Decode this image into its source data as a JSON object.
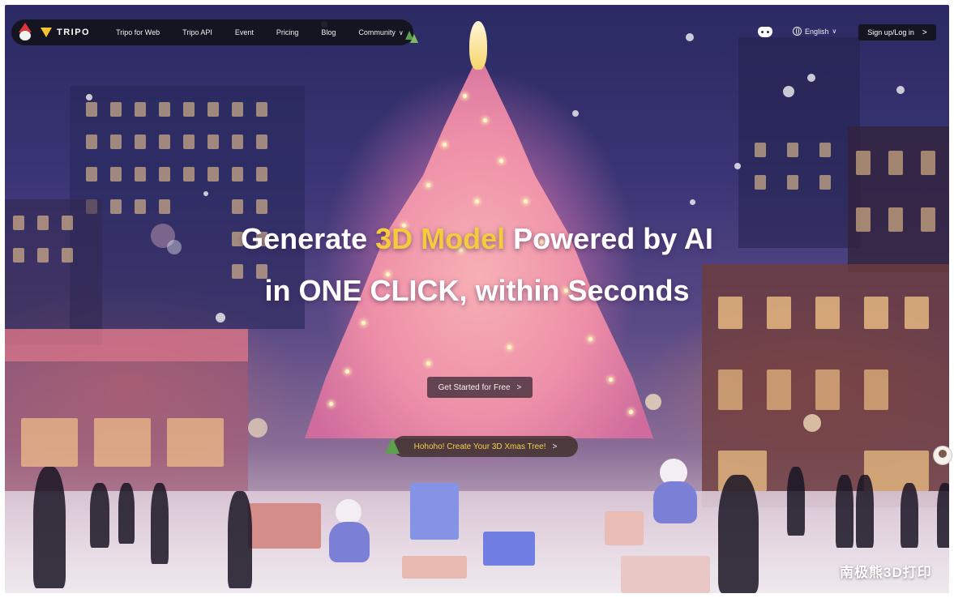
{
  "nav": {
    "brand": "TRIPO",
    "items": [
      {
        "label": "Tripo for Web"
      },
      {
        "label": "Tripo API"
      },
      {
        "label": "Event"
      },
      {
        "label": "Pricing"
      },
      {
        "label": "Blog"
      },
      {
        "label": "Community"
      }
    ],
    "community_chevron": "∨"
  },
  "header_right": {
    "language": "English",
    "language_chevron": "∨",
    "signup_label": "Sign up/Log in",
    "signup_arrow": ">"
  },
  "hero": {
    "line1_before": "Generate ",
    "line1_accent": "3D Model",
    "line1_after": " Powered by AI",
    "line2": "in ONE CLICK, within Seconds"
  },
  "cta": {
    "label": "Get Started for Free",
    "arrow": ">"
  },
  "promo": {
    "label": "Hohoho! Create Your 3D Xmas Tree!",
    "arrow": ">"
  },
  "watermark": "南极熊3D打印",
  "colors": {
    "accent": "#f4cb3c",
    "nav_bg": "#14141c"
  },
  "icons": [
    "santa-logo-icon",
    "tripo-logo-icon",
    "discord-icon",
    "globe-icon",
    "xmas-tree-icon",
    "chevron-down-icon",
    "chevron-right-icon"
  ]
}
